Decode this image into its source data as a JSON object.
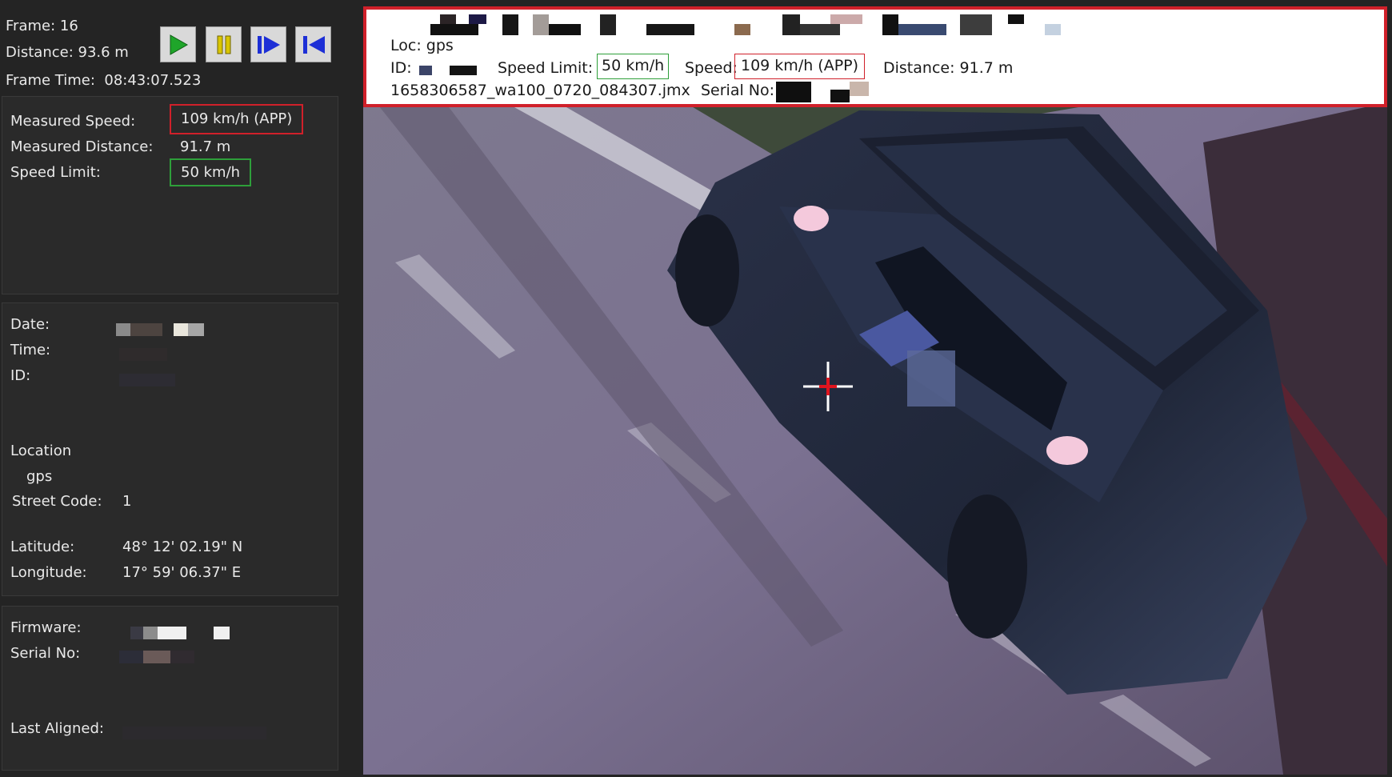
{
  "toolbar": {
    "frame": "Frame: 16",
    "distance": "Distance: 93.6 m",
    "frame_time": "Frame Time:  08:43:07.523",
    "buttons": [
      {
        "name": "play-button",
        "icon": "play-icon"
      },
      {
        "name": "pause-button",
        "icon": "pause-icon"
      },
      {
        "name": "step-forward-button",
        "icon": "step-forward-icon"
      },
      {
        "name": "skip-to-start-button",
        "icon": "skip-to-start-icon"
      }
    ]
  },
  "measurement": {
    "speed_label": "Measured Speed:",
    "speed_value": "109 km/h (APP)",
    "distance_label": "Measured Distance:",
    "distance_value": "91.7 m",
    "limit_label": "Speed Limit:",
    "limit_value": "50 km/h"
  },
  "details": {
    "date_label": "Date:",
    "time_label": "Time:",
    "id_label": "ID:",
    "location_label": "Location",
    "location_value": "gps",
    "street_code_label": "Street Code:",
    "street_code_value": "1",
    "latitude_label": "Latitude:",
    "latitude_value": "48° 12' 02.19\" N",
    "longitude_label": "Longitude:",
    "longitude_value": "17° 59' 06.37\" E"
  },
  "device": {
    "firmware_label": "Firmware:",
    "serial_label": "Serial No:",
    "last_aligned_label": "Last Aligned:"
  },
  "overlay": {
    "loc": "Loc: gps",
    "id_label": "ID:",
    "speed_limit_label": "Speed Limit:",
    "speed_limit_value": "50 km/h",
    "speed_label": "Speed:",
    "speed_value": "109 km/h (APP)",
    "distance": "Distance: 91.7 m",
    "filename": "1658306587_wa100_0720_084307.jmx",
    "serial_label": "Serial No:"
  },
  "colors": {
    "alert_red": "#d0202a",
    "ok_green": "#2e9f3a",
    "button_icon_blue": "#1d2fd6",
    "play_green": "#1fa52a",
    "pause_yellow": "#d9c600"
  }
}
